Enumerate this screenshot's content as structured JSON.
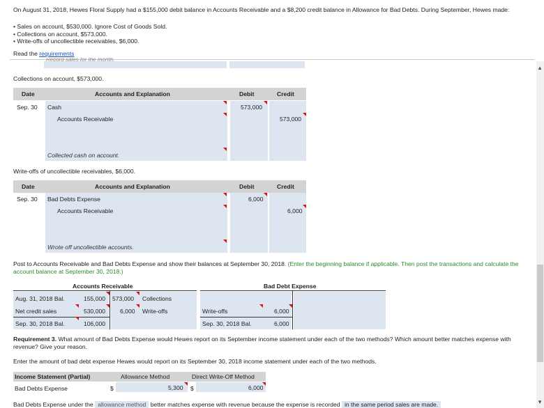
{
  "intro": {
    "paragraph": "On August 31, 2018, Hewes Floral Supply had a $155,000 debit balance in Accounts Receivable and a $8,200 credit balance in Allowance for Bad Debts. During September, Hewes made:",
    "bullets": [
      "Sales on account, $530,000. Ignore Cost of Goods Sold.",
      "Collections on account, $573,000.",
      "Write-offs of uncollectible receivables, $6,000."
    ],
    "read_prefix": "Read the ",
    "requirements_link": "requirements",
    "cut_text": "Record sales for the month."
  },
  "collections": {
    "label": "Collections on account, $573,000.",
    "headers": {
      "date": "Date",
      "accounts": "Accounts and Explanation",
      "debit": "Debit",
      "credit": "Credit"
    },
    "date": "Sep. 30",
    "row1_account": "Cash",
    "row1_debit": "573,000",
    "row2_account": "Accounts Receivable",
    "row2_credit": "573,000",
    "explanation": "Collected cash on account."
  },
  "writeoffs": {
    "label": "Write-offs of uncollectible receivables, $6,000.",
    "headers": {
      "date": "Date",
      "accounts": "Accounts and Explanation",
      "debit": "Debit",
      "credit": "Credit"
    },
    "date": "Sep. 30",
    "row1_account": "Bad Debts Expense",
    "row1_debit": "6,000",
    "row2_account": "Accounts Receivable",
    "row2_credit": "6,000",
    "explanation": "Wrote off uncollectible accounts."
  },
  "post": {
    "instruction": "Post to Accounts Receivable and Bad Debts Expense and show their balances at September 30, 2018.",
    "hint": "(Enter the beginning balance if applicable. Then post the transactions and calculate the account balance at September 30, 2018.)"
  },
  "ar_t": {
    "title": "Accounts Receivable",
    "rows": [
      {
        "left_label": "Aug. 31, 2018 Bal.",
        "left_value": "155,000",
        "right_value": "573,000",
        "right_label": "Collections"
      },
      {
        "left_label": "Net credit sales",
        "left_value": "530,000",
        "right_value": "6,000",
        "right_label": "Write-offs"
      },
      {
        "left_label": "Sep. 30, 2018 Bal.",
        "left_value": "106,000",
        "right_value": "",
        "right_label": ""
      }
    ]
  },
  "bde_t": {
    "title": "Bad Debt Expense",
    "rows": [
      {
        "left_label": "",
        "left_value": ""
      },
      {
        "left_label": "Write-offs",
        "left_value": "6,000"
      },
      {
        "left_label": "Sep. 30, 2018 Bal.",
        "left_value": "6,000"
      }
    ]
  },
  "req3": {
    "label": "Requirement 3.",
    "text": " What amount of Bad Debts Expense would Hewes report on its September income statement under each of the two methods? Which amount better matches expense with revenue? Give your reason.",
    "enter_text": "Enter the amount of bad debt expense Hewes would report on its September 30, 2018 income statement under each of the two methods.",
    "table_head": {
      "col1": "Income Statement (Partial)",
      "col2": "Allowance Method",
      "col3": "Direct Write-Off Method"
    },
    "row_label": "Bad Debts Expense",
    "dollar": "$",
    "allowance_value": "5,300",
    "direct_value": "6,000",
    "bottom_prefix": "Bad Debts Expense under the",
    "bottom_select1": "allowance method",
    "bottom_mid": "better matches expense with revenue because the expense is recorded",
    "bottom_select2": "in the same period sales are made."
  },
  "colors": {
    "input_bg": "#dde5f1",
    "header_bg": "#d3d3d3",
    "link": "#1a4fc0",
    "hint": "#2a8a2a",
    "marker": "#dd1111"
  }
}
